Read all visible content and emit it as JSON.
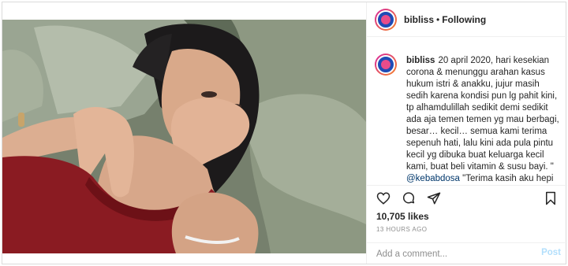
{
  "post": {
    "username": "bibliss",
    "separator": "•",
    "follow_status": "Following",
    "caption": {
      "username": "bibliss",
      "text": "20 april 2020, hari kesekian corona & menunggu arahan kasus hukum istri & anakku, jujur masih sedih karena kondisi pun lg pahit kini, tp alhamdulillah sedikit demi sedikit ada aja temen temen yg mau berbagi, besar… kecil… semua kami terima sepenuh hati, lalu kini ada pula pintu kecil yg dibuka buat keluarga kecil kami, buat beli vitamin & susu bayi. \"",
      "mention": "@kebabdosa",
      "after_mention": " \"Terima kasih aku hepi"
    },
    "likes": "10,705 likes",
    "timestamp": "13 HOURS AGO",
    "comment_placeholder": "Add a comment...",
    "post_label": "Post",
    "icons": [
      "heart-icon",
      "comment-icon",
      "share-icon",
      "bookmark-icon"
    ],
    "colors": {
      "link": "#00376b",
      "muted": "#8e8e8e",
      "post_disabled": "#b2dffc",
      "border": "#dbdbdb"
    }
  }
}
